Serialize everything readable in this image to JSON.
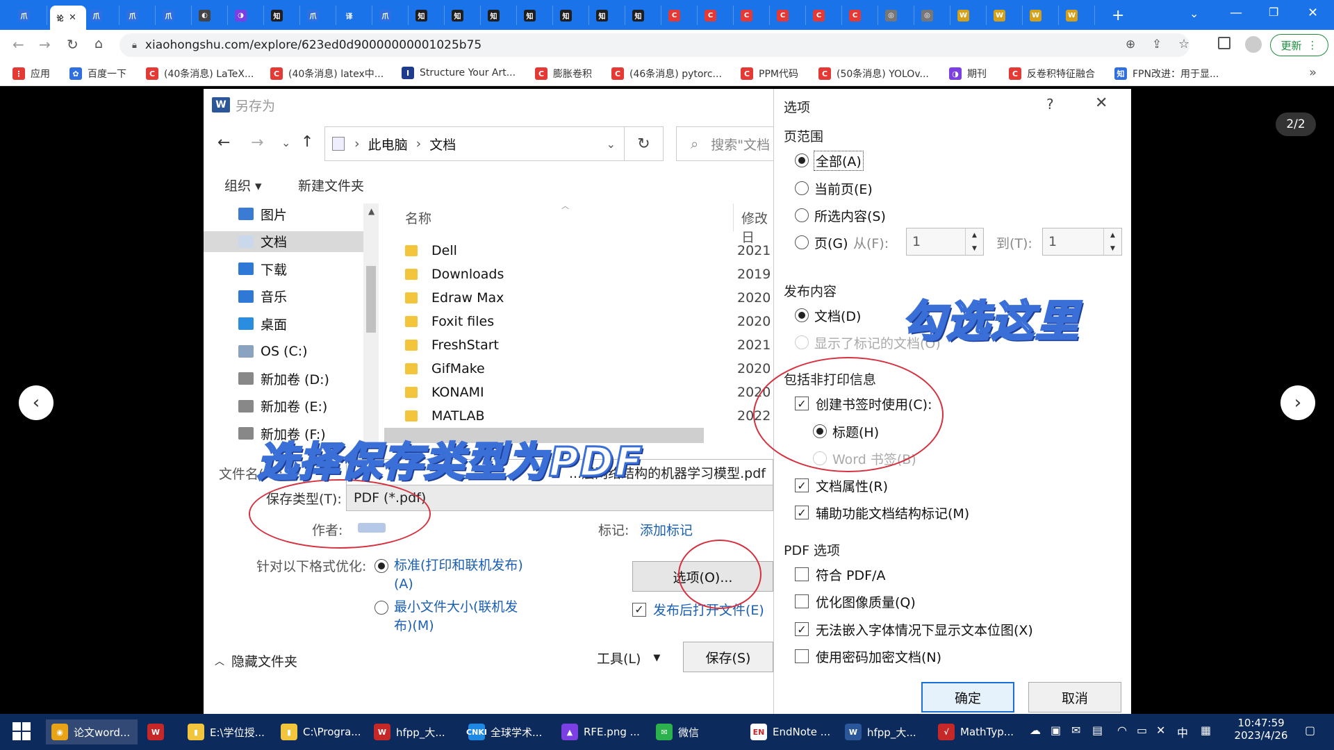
{
  "browser": {
    "tabs": [
      {
        "glyph": "爪",
        "color": "#2f6fe0"
      },
      {
        "glyph": "论",
        "color": "#ffffff",
        "active": true
      },
      {
        "glyph": "爪",
        "color": "#2f6fe0"
      },
      {
        "glyph": "爪",
        "color": "#2f6fe0"
      },
      {
        "glyph": "爪",
        "color": "#2f6fe0"
      },
      {
        "glyph": "◐",
        "color": "#444444"
      },
      {
        "glyph": "◑",
        "color": "#7b3fe4"
      },
      {
        "glyph": "知",
        "color": "#1e1e1e"
      },
      {
        "glyph": "爪",
        "color": "#2f6fe0"
      },
      {
        "glyph": "译",
        "color": "#1a73e8"
      },
      {
        "glyph": "爪",
        "color": "#2f6fe0"
      },
      {
        "glyph": "知",
        "color": "#1e1e1e"
      },
      {
        "glyph": "知",
        "color": "#1e1e1e"
      },
      {
        "glyph": "知",
        "color": "#1e1e1e"
      },
      {
        "glyph": "知",
        "color": "#1e1e1e"
      },
      {
        "glyph": "知",
        "color": "#1e1e1e"
      },
      {
        "glyph": "知",
        "color": "#1e1e1e"
      },
      {
        "glyph": "知",
        "color": "#1e1e1e"
      },
      {
        "glyph": "C",
        "color": "#e53935"
      },
      {
        "glyph": "C",
        "color": "#e53935"
      },
      {
        "glyph": "C",
        "color": "#e53935"
      },
      {
        "glyph": "C",
        "color": "#e53935"
      },
      {
        "glyph": "C",
        "color": "#e53935"
      },
      {
        "glyph": "C",
        "color": "#e53935"
      },
      {
        "glyph": "◎",
        "color": "#777777"
      },
      {
        "glyph": "◎",
        "color": "#777777"
      },
      {
        "glyph": "W",
        "color": "#d4a017"
      },
      {
        "glyph": "W",
        "color": "#d4a017"
      },
      {
        "glyph": "W",
        "color": "#d4a017"
      },
      {
        "glyph": "W",
        "color": "#d4a017"
      }
    ],
    "active_tab_close": "✕",
    "new_tab": "+",
    "url": "xiaohongshu.com/explore/623ed0d90000000001025b75",
    "update_label": "更新",
    "bookmarks": [
      {
        "label": "应用",
        "color": "#e53935",
        "glyph": "⋮"
      },
      {
        "label": "百度一下",
        "color": "#2f6fe0",
        "glyph": "✿"
      },
      {
        "label": "(40条消息) LaTeX...",
        "color": "#e53935",
        "glyph": "C"
      },
      {
        "label": "(40条消息) latex中...",
        "color": "#e53935",
        "glyph": "C"
      },
      {
        "label": "Structure Your Art...",
        "color": "#1f3b8c",
        "glyph": "I"
      },
      {
        "label": "膨胀卷积",
        "color": "#e53935",
        "glyph": "C"
      },
      {
        "label": "(46条消息) pytorc...",
        "color": "#e53935",
        "glyph": "C"
      },
      {
        "label": "PPM代码",
        "color": "#e53935",
        "glyph": "C"
      },
      {
        "label": "(50条消息) YOLOv...",
        "color": "#e53935",
        "glyph": "C"
      },
      {
        "label": "期刊",
        "color": "#7b3fe4",
        "glyph": "◑"
      },
      {
        "label": "反卷积特征融合",
        "color": "#e53935",
        "glyph": "C"
      },
      {
        "label": "FPN改进：用于显...",
        "color": "#2f6fe0",
        "glyph": "知"
      }
    ],
    "bookmarks_more": "»"
  },
  "viewer": {
    "page_counter": "2/2",
    "prev": "‹",
    "next": "›"
  },
  "save_dialog": {
    "title": "另存为",
    "path": [
      "此电脑",
      "文档"
    ],
    "search_placeholder": "搜索\"文档",
    "organize": "组织 ▾",
    "new_folder": "新建文件夹",
    "tree": [
      {
        "label": "图片",
        "color": "#3c7bd4"
      },
      {
        "label": "文档",
        "color": "#c9d8ea",
        "selected": true
      },
      {
        "label": "下载",
        "color": "#2f78d6"
      },
      {
        "label": "音乐",
        "color": "#2f78d6"
      },
      {
        "label": "桌面",
        "color": "#2b8de0"
      },
      {
        "label": "OS (C:)",
        "color": "#8aa3c0"
      },
      {
        "label": "新加卷 (D:)",
        "color": "#888888"
      },
      {
        "label": "新加卷 (E:)",
        "color": "#888888"
      },
      {
        "label": "新加卷 (F:)",
        "color": "#888888"
      }
    ],
    "col_name": "名称",
    "col_modified": "修改日",
    "files": [
      {
        "name": "Dell",
        "date": "2021"
      },
      {
        "name": "Downloads",
        "date": "2019"
      },
      {
        "name": "Edraw Max",
        "date": "2020"
      },
      {
        "name": "Foxit files",
        "date": "2020"
      },
      {
        "name": "FreshStart",
        "date": "2021"
      },
      {
        "name": "GifMake",
        "date": "2020"
      },
      {
        "name": "KONAMI",
        "date": "2020"
      },
      {
        "name": "MATLAB",
        "date": "2022"
      }
    ],
    "filename_label": "文件名(N):",
    "filename_value": "...层网络结构的机器学习模型.pdf",
    "filetype_label": "保存类型(T):",
    "filetype_value": "PDF (*.pdf)",
    "author_label": "作者:",
    "tags_label": "标记:",
    "tags_value": "添加标记",
    "optimize_label": "针对以下格式优化:",
    "opt_standard": "标准(打印和联机发布)(A)",
    "opt_min": "最小文件大小(联机发布)(M)",
    "options_btn": "选项(O)...",
    "open_after": "发布后打开文件(E)",
    "hide_folders": "隐藏文件夹",
    "tools": "工具(L)",
    "save_btn": "保存(S)"
  },
  "options_dialog": {
    "title": "选项",
    "help": "?",
    "close": "✕",
    "page_range": "页范围",
    "pr_all": "全部(A)",
    "pr_current": "当前页(E)",
    "pr_selection": "所选内容(S)",
    "pr_pages": "页(G)",
    "from_label": "从(F):",
    "from_value": "1",
    "to_label": "到(T):",
    "to_value": "1",
    "publish_what": "发布内容",
    "pw_document": "文档(D)",
    "pw_markup": "显示了标记的文档(O)",
    "non_print": "包括非打印信息",
    "np_bookmarks": "创建书签时使用(C):",
    "np_headings": "标题(H)",
    "np_word_bookmarks": "Word 书签(B)",
    "np_props": "文档属性(R)",
    "np_struct": "辅助功能文档结构标记(M)",
    "pdf_options": "PDF 选项",
    "po_pdfa": "符合 PDF/A",
    "po_image": "优化图像质量(Q)",
    "po_bitmap": "无法嵌入字体情况下显示文本位图(X)",
    "po_encrypt": "使用密码加密文档(N)",
    "ok": "确定",
    "cancel": "取消"
  },
  "annotations": {
    "check_here": "勾选这里",
    "choose_pdf": "选择保存类型为PDF"
  },
  "taskbar": {
    "items": [
      {
        "label": "论文word...",
        "color": "#e8a317",
        "glyph": "◉"
      },
      {
        "label": "",
        "color": "#c62828",
        "glyph": "W"
      },
      {
        "label": "E:\\学位授...",
        "color": "#f2c53d",
        "glyph": "▮"
      },
      {
        "label": "C:\\Progra...",
        "color": "#f2c53d",
        "glyph": "▮"
      },
      {
        "label": "hfpp_大...",
        "color": "#c62828",
        "glyph": "W"
      },
      {
        "label": "全球学术...",
        "color": "#1e88e5",
        "glyph": "CNKI"
      },
      {
        "label": "RFE.png ...",
        "color": "#7b3fe4",
        "glyph": "▲"
      },
      {
        "label": "微信",
        "color": "#2bb24c",
        "glyph": "✉"
      },
      {
        "label": "EndNote ...",
        "color": "#ffffff",
        "glyph": "EN"
      },
      {
        "label": "hfpp_大...",
        "color": "#2b579a",
        "glyph": "W"
      },
      {
        "label": "MathTyp...",
        "color": "#c62828",
        "glyph": "√"
      }
    ],
    "ime": "中",
    "time": "10:47:59",
    "date": "2023/4/26"
  }
}
